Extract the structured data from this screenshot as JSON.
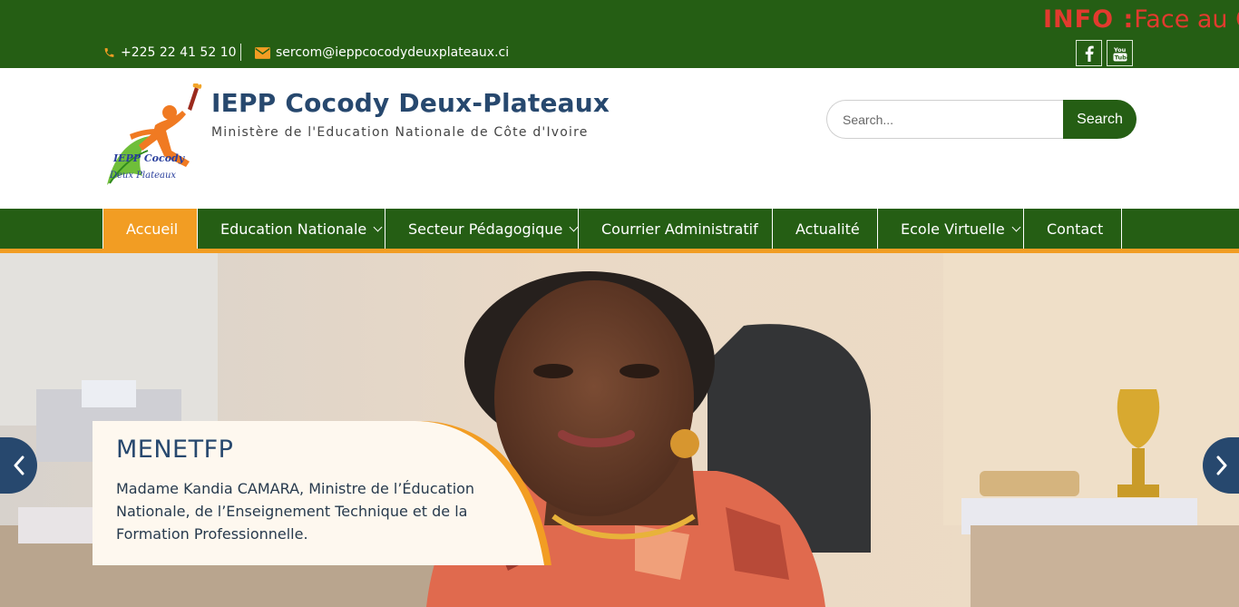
{
  "topbar": {
    "ticker_tag": "INFO :",
    "ticker_text": "Face au C",
    "phone": "+225 22 41 52 10",
    "email": "sercom@ieppcocodydeuxplateaux.ci",
    "social": [
      {
        "icon": "facebook-icon"
      },
      {
        "icon": "youtube-icon"
      }
    ]
  },
  "header": {
    "logo_lines": [
      "IEPP Cocody",
      "Deux Plateaux"
    ],
    "title": "IEPP Cocody Deux-Plateaux",
    "tagline": "Ministère de l'Education Nationale de Côte d'Ivoire"
  },
  "search": {
    "placeholder": "Search...",
    "button_label": "Search"
  },
  "nav": {
    "items": [
      {
        "label": "Accueil",
        "active": true
      },
      {
        "label": "Education Nationale",
        "dropdown": true
      },
      {
        "label": "Secteur Pédagogique",
        "dropdown": true
      },
      {
        "label": "Courrier Administratif"
      },
      {
        "label": "Actualité"
      },
      {
        "label": "Ecole Virtuelle",
        "dropdown": true
      },
      {
        "label": "Contact"
      }
    ]
  },
  "slider": {
    "title": "MENETFP",
    "text": "Madame Kandia CAMARA, Ministre de l’Éducation Nationale, de l’Enseignement Technique et de la Formation Professionnelle.",
    "prev_icon": "chevron-left-icon",
    "next_icon": "chevron-right-icon"
  },
  "colors": {
    "brand_green": "#255e14",
    "accent_orange": "#f29d23",
    "title_blue": "#27486e",
    "ticker_red": "#e23a2e"
  }
}
